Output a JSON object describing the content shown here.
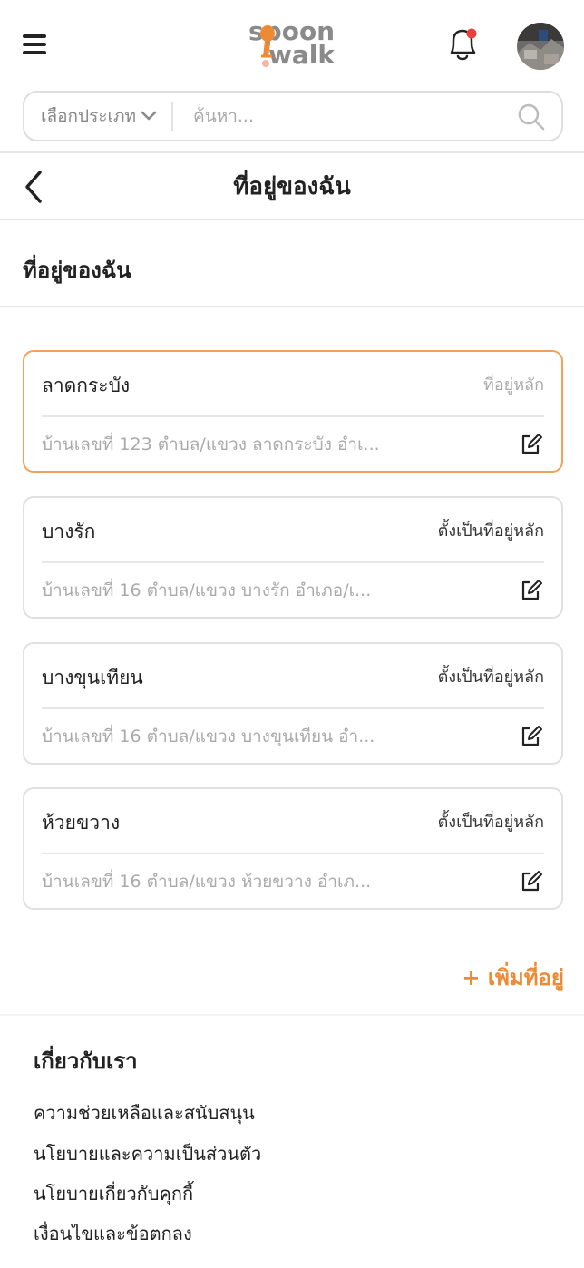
{
  "header": {
    "logo_line1": "spoon",
    "logo_line2": "walk",
    "notification_dot_color": "#e8413c"
  },
  "search": {
    "category_label": "เลือกประเภท",
    "placeholder": "ค้นหา..."
  },
  "nav": {
    "title": "ที่อยู่ของฉัน"
  },
  "section": {
    "title": "ที่อยู่ของฉัน"
  },
  "addresses": [
    {
      "name": "ลาดกระบัง",
      "action": "ที่อยู่หลัก",
      "detail": "บ้านเลขที่ 123 ตำบล/แขวง ลาดกระบัง อำเ...",
      "is_primary": true
    },
    {
      "name": "บางรัก",
      "action": "ตั้งเป็นที่อยู่หลัก",
      "detail": "บ้านเลขที่ 16 ตำบล/แขวง บางรัก อำเภอ/เ...",
      "is_primary": false
    },
    {
      "name": "บางขุนเทียน",
      "action": "ตั้งเป็นที่อยู่หลัก",
      "detail": "บ้านเลขที่ 16 ตำบล/แขวง บางขุนเทียน อำ...",
      "is_primary": false
    },
    {
      "name": "ห้วยขวาง",
      "action": "ตั้งเป็นที่อยู่หลัก",
      "detail": "บ้านเลขที่ 16 ตำบล/แขวง ห้วยขวาง อำเภ...",
      "is_primary": false
    }
  ],
  "add_address_label": "+ เพิ่มที่อยู่",
  "footer": {
    "title": "เกี่ยวกับเรา",
    "links": [
      "ความช่วยเหลือและสนับสนุน",
      "นโยบายและความเป็นส่วนตัว",
      "นโยบายเกี่ยวกับคุกกี้",
      "เงื่อนไขและข้อตกลง"
    ]
  },
  "colors": {
    "accent": "#ee8a34",
    "primary_border": "#f0a25a",
    "logo_gray": "#8a8a8a"
  }
}
